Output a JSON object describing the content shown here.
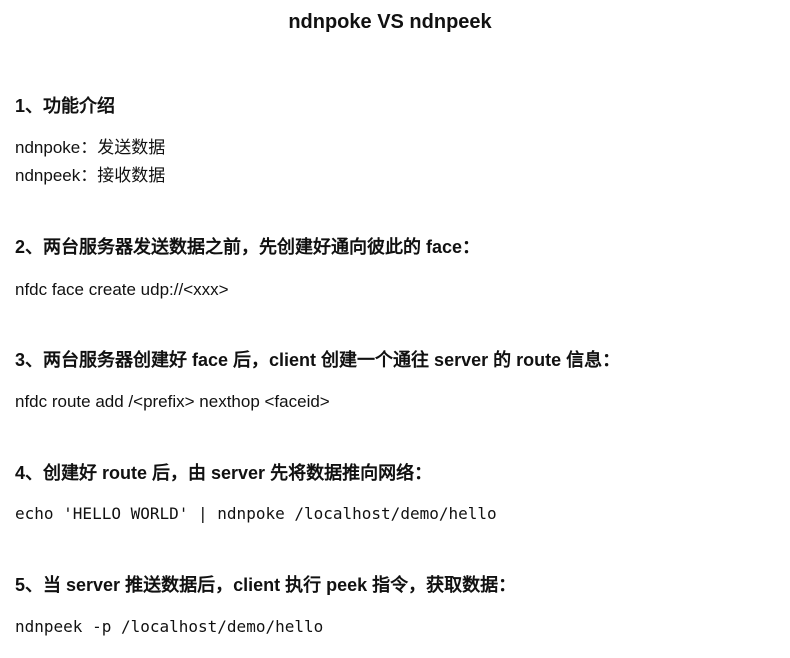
{
  "document": {
    "title": "ndnpoke VS ndnpeek",
    "sections": [
      {
        "heading": "1、功能介绍",
        "lines": [
          "ndnpoke：发送数据",
          "ndnpeek：接收数据"
        ]
      },
      {
        "heading": "2、两台服务器发送数据之前，先创建好通向彼此的 face：",
        "lines": [
          "nfdc face create udp://<xxx>"
        ]
      },
      {
        "heading": "3、两台服务器创建好 face 后，client 创建一个通往 server 的 route 信息：",
        "lines": [
          "nfdc route add /<prefix> nexthop <faceid>"
        ]
      },
      {
        "heading": "4、创建好 route 后，由 server 先将数据推向网络：",
        "lines": [
          "echo 'HELLO WORLD' | ndnpoke /localhost/demo/hello"
        ]
      },
      {
        "heading": "5、当 server 推送数据后，client 执行 peek 指令，获取数据：",
        "lines": [
          "ndnpeek -p /localhost/demo/hello"
        ]
      }
    ]
  }
}
